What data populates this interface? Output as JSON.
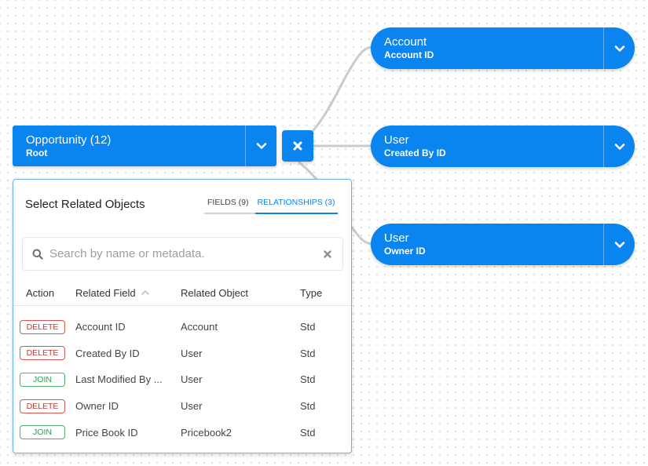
{
  "colors": {
    "accent": "#0a84ee",
    "connector": "#c8cccf",
    "delete": "#c23934",
    "join": "#2e9e4f"
  },
  "root_node": {
    "title": "Opportunity (12)",
    "subtitle": "Root",
    "toggle_icon": "chevron-down-icon"
  },
  "remove_icon": "close-icon",
  "child_nodes": [
    {
      "title": "Account",
      "subtitle": "Account ID",
      "toggle_icon": "chevron-down-icon"
    },
    {
      "title": "User",
      "subtitle": "Created By ID",
      "toggle_icon": "chevron-down-icon"
    },
    {
      "title": "User",
      "subtitle": "Owner ID",
      "toggle_icon": "chevron-down-icon"
    }
  ],
  "panel": {
    "title": "Select Related Objects",
    "tabs": [
      {
        "label": "FIELDS (9)",
        "active": false
      },
      {
        "label": "RELATIONSHIPS (3)",
        "active": true
      }
    ],
    "search": {
      "placeholder": "Search by name or metadata.",
      "value": ""
    },
    "columns": [
      "Action",
      "Related Field",
      "Related Object",
      "Type"
    ],
    "rows": [
      {
        "action": "DELETE",
        "field": "Account ID",
        "object": "Account",
        "type": "Std"
      },
      {
        "action": "DELETE",
        "field": "Created By ID",
        "object": "User",
        "type": "Std"
      },
      {
        "action": "JOIN",
        "field": "Last Modified By ...",
        "object": "User",
        "type": "Std"
      },
      {
        "action": "DELETE",
        "field": "Owner ID",
        "object": "User",
        "type": "Std"
      },
      {
        "action": "JOIN",
        "field": "Price Book ID",
        "object": "Pricebook2",
        "type": "Std"
      }
    ]
  }
}
